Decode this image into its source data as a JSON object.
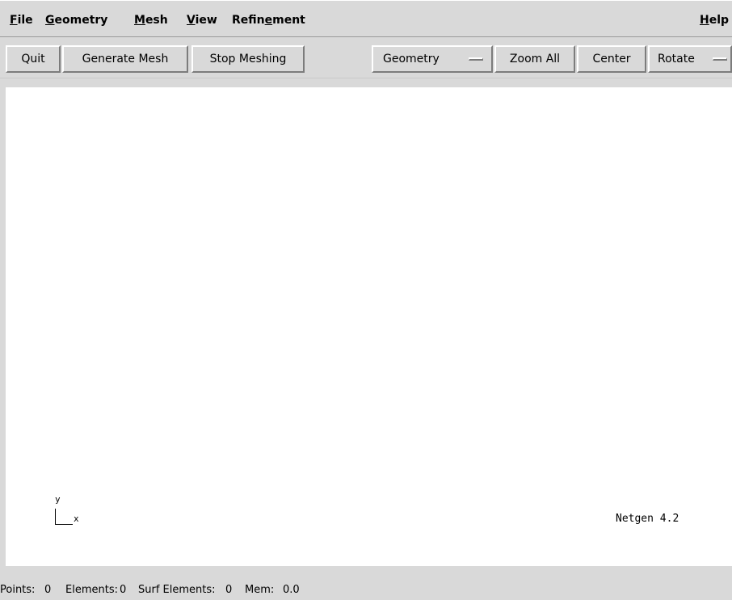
{
  "menubar": {
    "items": [
      {
        "mnemonic": "F",
        "rest": "ile"
      },
      {
        "mnemonic": "G",
        "rest": "eometry"
      },
      {
        "mnemonic": "M",
        "rest": "esh"
      },
      {
        "mnemonic": "V",
        "rest": "iew"
      },
      {
        "pre": "Refin",
        "mnemonic": "e",
        "rest": "ment"
      }
    ],
    "help": {
      "mnemonic": "H",
      "rest": "elp"
    }
  },
  "toolbar": {
    "quit_label": "Quit",
    "generate_mesh_label": "Generate Mesh",
    "stop_meshing_label": "Stop Meshing",
    "view_select_value": "Geometry",
    "zoom_all_label": "Zoom All",
    "center_label": "Center",
    "mouse_mode_value": "Rotate"
  },
  "canvas": {
    "background": "#ffffff",
    "axis_y": "y",
    "axis_x": "x",
    "version": "Netgen 4.2"
  },
  "status": {
    "points_label": "Points:",
    "points_value": "0",
    "elements_label": "Elements:",
    "elements_value": "0",
    "surf_elements_label": "Surf Elements:",
    "surf_elements_value": "0",
    "mem_label": "Mem:",
    "mem_value": "0.0"
  }
}
